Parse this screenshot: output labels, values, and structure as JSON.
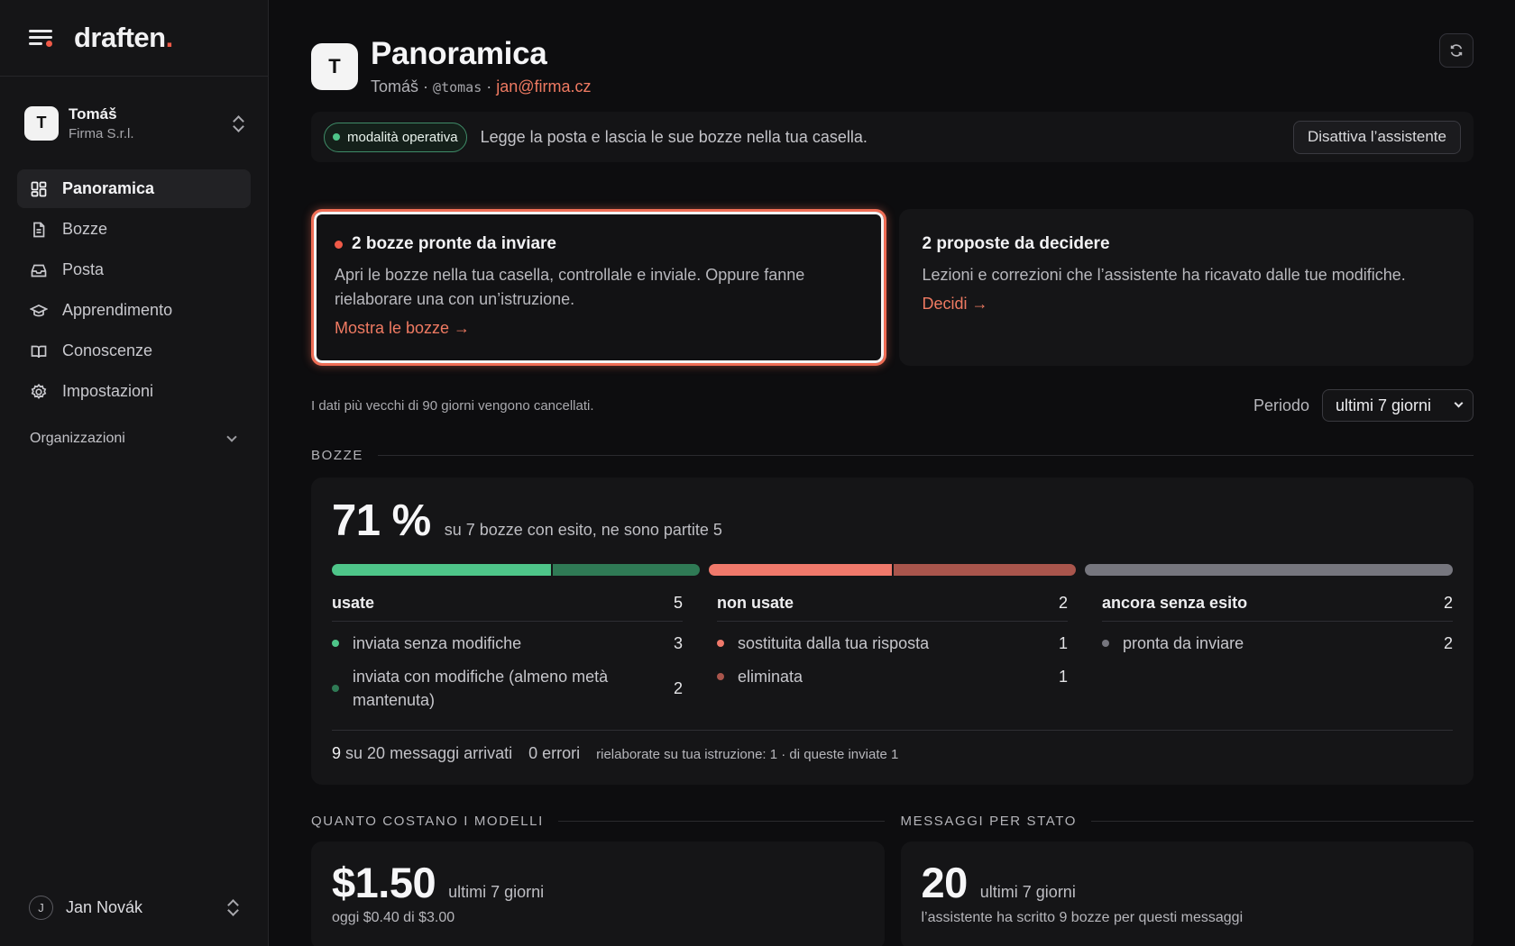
{
  "brand": {
    "name": "draften",
    "dot": "."
  },
  "account": {
    "initial": "T",
    "name": "Tomáš",
    "org": "Firma S.r.l."
  },
  "nav": {
    "items": [
      {
        "label": "Panoramica",
        "icon": "dashboard-icon"
      },
      {
        "label": "Bozze",
        "icon": "document-icon"
      },
      {
        "label": "Posta",
        "icon": "inbox-icon"
      },
      {
        "label": "Apprendimento",
        "icon": "graduation-cap-icon"
      },
      {
        "label": "Conoscenze",
        "icon": "book-icon"
      },
      {
        "label": "Impostazioni",
        "icon": "gear-icon"
      }
    ],
    "group_label": "Organizzazioni"
  },
  "user": {
    "initial": "J",
    "name": "Jan Novák"
  },
  "header": {
    "initial": "T",
    "title": "Panoramica",
    "name": "Tomáš",
    "sep": "·",
    "handle": "@tomas",
    "email": "jan@firma.cz"
  },
  "mode": {
    "badge": "modalità operativa",
    "text": "Legge la posta e lascia le sue bozze nella tua casella.",
    "button": "Disattiva l’assistente"
  },
  "cards": [
    {
      "title": "2 bozze pronte da inviare",
      "text": "Apri le bozze nella tua casella, controllale e inviale. Oppure fanne rielaborare una con un’istruzione.",
      "link": "Mostra le bozze →"
    },
    {
      "title": "2 proposte da decidere",
      "text": "Lezioni e correzioni che l’assistente ha ricavato dalle tue modifiche.",
      "link": "Decidi →"
    }
  ],
  "retention_note": "I dati più vecchi di 90 giorni vengono cancellati.",
  "period": {
    "label": "Periodo",
    "selected": "ultimi 7 giorni"
  },
  "drafts_section": {
    "title": "BOZZE",
    "percent": "71 %",
    "summary": "su 7 bozze con esito, ne sono partite 5",
    "columns": [
      {
        "label": "usate",
        "count": "5",
        "rows": [
          {
            "label": "inviata senza modifiche",
            "count": "3",
            "color": "#4ec589"
          },
          {
            "label": "inviata con modifiche (almeno metà mantenuta)",
            "count": "2",
            "color": "#2f7a55"
          }
        ]
      },
      {
        "label": "non usate",
        "count": "2",
        "rows": [
          {
            "label": "sostituita dalla tua risposta",
            "count": "1",
            "color": "#f0796b"
          },
          {
            "label": "eliminata",
            "count": "1",
            "color": "#a9554c"
          }
        ]
      },
      {
        "label": "ancora senza esito",
        "count": "2",
        "rows": [
          {
            "label": "pronta da inviare",
            "count": "2",
            "color": "#76767e"
          }
        ]
      }
    ],
    "bar_segments": [
      {
        "group": 0,
        "value": 3,
        "color": "#4ec589"
      },
      {
        "group": 0,
        "value": 2,
        "color": "#2f7a55"
      },
      {
        "group": 1,
        "value": 1,
        "color": "#f0796b"
      },
      {
        "group": 1,
        "value": 1,
        "color": "#a9554c"
      },
      {
        "group": 2,
        "value": 2,
        "color": "#76767e"
      }
    ],
    "footer": {
      "arrived_num": "9",
      "arrived_text": "su 20 messaggi arrivati",
      "errors": "0 errori",
      "reworked": "rielaborate su tua istruzione: 1 · di queste inviate 1"
    }
  },
  "costs": {
    "title": "QUANTO COSTANO I MODELLI",
    "amount": "$1.50",
    "period": "ultimi 7 giorni",
    "today": "oggi $0.40 di $3.00"
  },
  "messages": {
    "title": "MESSAGGI PER STATO",
    "count": "20",
    "period": "ultimi 7 giorni",
    "note": "l’assistente ha scritto 9 bozze per questi messaggi"
  }
}
